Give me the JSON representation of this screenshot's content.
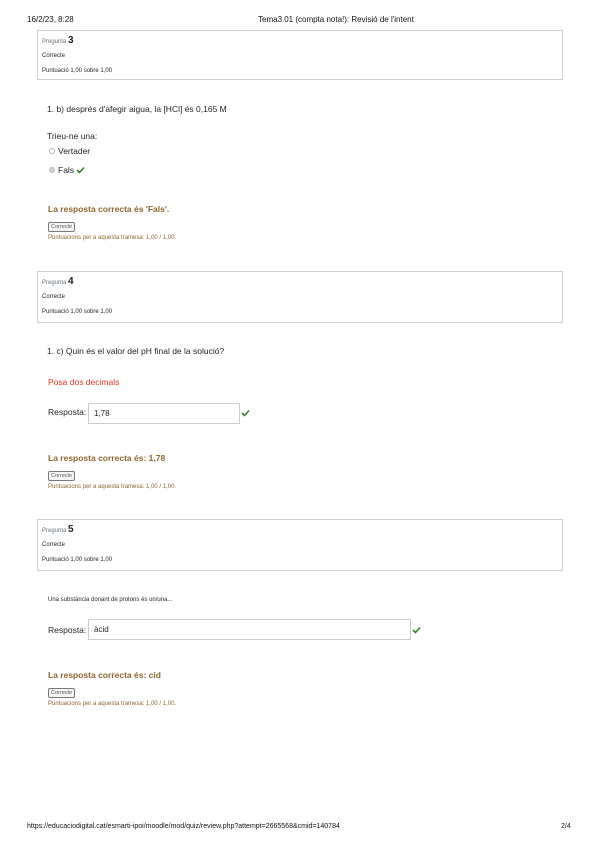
{
  "header": {
    "datetime": "16/2/23, 8:28",
    "title": "Tema3.01 (compta nota!): Revisió de l'intent"
  },
  "questions": [
    {
      "label": "Pregunta",
      "number": "3",
      "state": "Correcte",
      "grade": "Puntuació 1,00 sobre 1,00",
      "text": "1. b) després d'afegir aigua, la [HCl] és 0,165 M",
      "prompt": "Trieu-ne una:",
      "options": [
        "Vertader",
        "Fals"
      ],
      "selected": "Fals",
      "feedback": "La resposta correcta és 'Fals'.",
      "badge": "Correcte",
      "marks": "Puntuacions per a aquesta tramesa: 1,00 / 1,00."
    },
    {
      "label": "Pregunta",
      "number": "4",
      "state": "Correcte",
      "grade": "Puntuació 1,00 sobre 1,00",
      "text": "1. c) Quin és el valor del pH final de la solució?",
      "note": "Posa dos decimals",
      "answer_label": "Resposta:",
      "answer": "1,78",
      "feedback": "La resposta correcta és: 1,78",
      "badge": "Correcte",
      "marks": "Puntuacions per a aquesta tramesa: 1,00 / 1,00."
    },
    {
      "label": "Pregunta",
      "number": "5",
      "state": "Correcte",
      "grade": "Puntuació 1,00 sobre 1,00",
      "text": "Una substància donant de protons és un/una...",
      "answer_label": "Resposta:",
      "answer": "àcid",
      "feedback": "La resposta correcta és: cid",
      "badge": "Correcte",
      "marks": "Puntuacions per a aquesta tramesa: 1,00 / 1,00."
    }
  ],
  "footer": {
    "url": "https://educaciodigital.cat/esmarti-ipoi/moodle/mod/quiz/review.php?attempt=2665568&cmid=140784",
    "page": "2/4"
  },
  "colors": {
    "feedback": "#8e662e",
    "correct_check": "#3d7a35",
    "note_red": "#e63224",
    "box_border": "#cfcfcf"
  },
  "icons": [
    "check-icon"
  ]
}
